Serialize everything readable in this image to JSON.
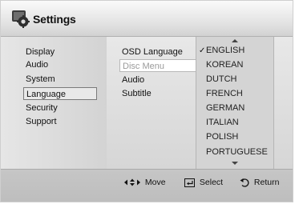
{
  "header": {
    "title": "Settings",
    "icon": "settings-gear-icon"
  },
  "sidebar": {
    "items": [
      {
        "label": "Display"
      },
      {
        "label": "Audio"
      },
      {
        "label": "System"
      },
      {
        "label": "Language",
        "selected": true
      },
      {
        "label": "Security"
      },
      {
        "label": "Support"
      }
    ]
  },
  "language_options": {
    "items": [
      {
        "label": "OSD Language"
      },
      {
        "label": "Disc Menu",
        "highlighted": true
      },
      {
        "label": "Audio"
      },
      {
        "label": "Subtitle"
      }
    ]
  },
  "dropdown": {
    "checked_value": "ENGLISH",
    "items": [
      {
        "label": "ENGLISH",
        "checked": true
      },
      {
        "label": "KOREAN"
      },
      {
        "label": "DUTCH"
      },
      {
        "label": "FRENCH"
      },
      {
        "label": "GERMAN"
      },
      {
        "label": "ITALIAN"
      },
      {
        "label": "POLISH"
      },
      {
        "label": "PORTUGUESE"
      }
    ],
    "up_arrow_icon": "scroll-up-icon",
    "down_arrow_icon": "scroll-down-icon"
  },
  "footer": {
    "move_label": "Move",
    "select_label": "Select",
    "return_label": "Return"
  }
}
